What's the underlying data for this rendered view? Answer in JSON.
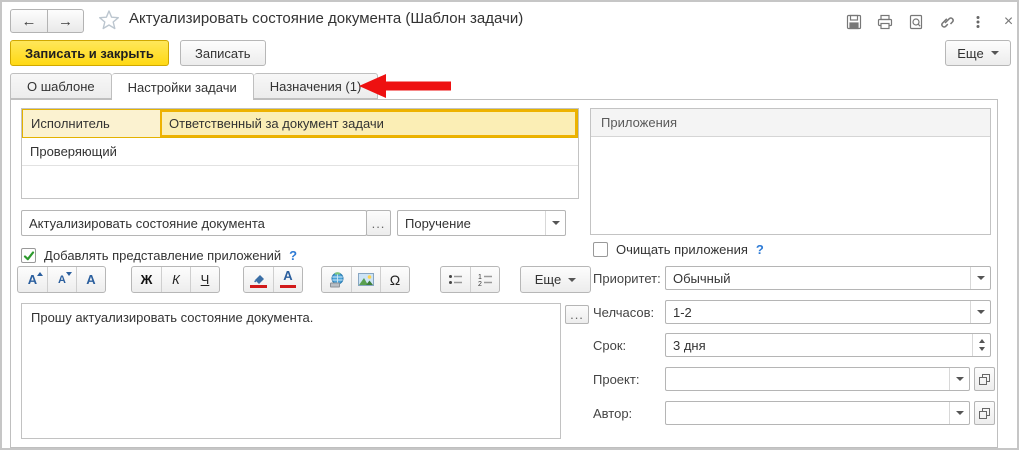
{
  "titlebar": {
    "title": "Актуализировать состояние документа (Шаблон задачи)",
    "back": "←",
    "forward": "→",
    "close": "×"
  },
  "actions": {
    "save_and_close": "Записать и закрыть",
    "save": "Записать",
    "more": "Еще"
  },
  "tabs": [
    {
      "label": "О шаблоне",
      "active": false
    },
    {
      "label": "Настройки задачи",
      "active": true
    },
    {
      "label": "Назначения (1)",
      "active": false
    }
  ],
  "roles_table": {
    "rows": [
      {
        "role": "Исполнитель",
        "value": "Ответственный за документ задачи",
        "selected": true
      },
      {
        "role": "Проверяющий",
        "value": "",
        "selected": false
      }
    ]
  },
  "subject": {
    "value": "Актуализировать состояние документа",
    "ellipsis": "...",
    "task_type": "Поручение"
  },
  "add_attachments_checkbox": {
    "label": "Добавлять представление приложений",
    "help": "?",
    "checked": true
  },
  "editor": {
    "toolbar": {
      "font_increase": "А",
      "font_decrease": "А",
      "font": "А",
      "bold": "Ж",
      "italic": "К",
      "underline": "Ч",
      "omega": "Ω",
      "more": "Еще"
    },
    "text": "Прошу актуализировать состояние документа.",
    "ellipsis": "..."
  },
  "attachments_panel": {
    "header": "Приложения"
  },
  "clear_attachments_checkbox": {
    "label": "Очищать приложения",
    "help": "?",
    "checked": false
  },
  "fields": {
    "priority": {
      "label": "Приоритет:",
      "value": "Обычный"
    },
    "manhours": {
      "label": "Челчасов:",
      "value": "1-2"
    },
    "term": {
      "label": "Срок:",
      "value": "3 дня"
    },
    "project": {
      "label": "Проект:",
      "value": ""
    },
    "author": {
      "label": "Автор:",
      "value": ""
    }
  },
  "colors": {
    "primary_button": "#ffdd2b",
    "selected_row_border": "#eeb200",
    "annotation_arrow": "#ee1111",
    "help_link": "#2e7bd6"
  }
}
